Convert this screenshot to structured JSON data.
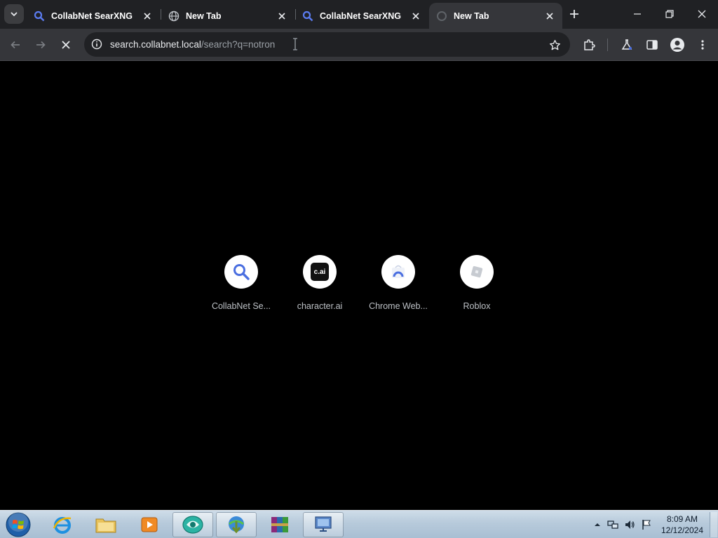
{
  "tabs": [
    {
      "title": "CollabNet SearXNG",
      "favicon": "search-icon",
      "active": false
    },
    {
      "title": "New Tab",
      "favicon": "globe-icon",
      "active": false
    },
    {
      "title": "CollabNet SearXNG",
      "favicon": "search-icon",
      "active": false
    },
    {
      "title": "New Tab",
      "favicon": "loading-icon",
      "active": true
    }
  ],
  "toolbar": {
    "url_host": "search.collabnet.local",
    "url_path": "/search?q=notron"
  },
  "shortcuts": [
    {
      "label": "CollabNet Se...",
      "icon": "search-icon"
    },
    {
      "label": "character.ai",
      "icon": "character-ai-logo",
      "logo_text": "c.ai"
    },
    {
      "label": "Chrome Web...",
      "icon": "chrome-web-store-icon"
    },
    {
      "label": "Roblox",
      "icon": "roblox-icon"
    }
  ],
  "taskbar": {
    "time": "8:09 AM",
    "date": "12/12/2024"
  },
  "colors": {
    "tabstrip": "#202124",
    "toolbar": "#35363a",
    "content_bg": "#000000",
    "accent": "#4a6ee0"
  }
}
